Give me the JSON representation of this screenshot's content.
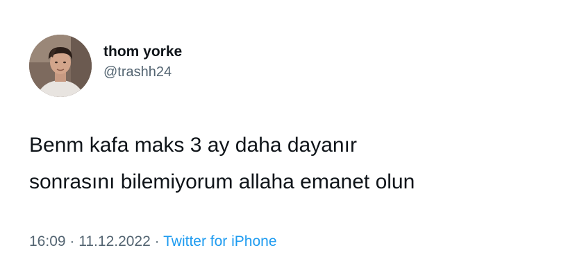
{
  "author": {
    "display_name": "thom yorke",
    "handle": "@trashh24"
  },
  "tweet": {
    "lines": [
      "Benm kafa maks 3 ay daha dayanır",
      "sonrasını bilemiyorum allaha emanet olun"
    ],
    "time": "16:09",
    "separator": "·",
    "date": "11.12.2022",
    "source": "Twitter for iPhone"
  },
  "colors": {
    "text": "#0f1419",
    "secondary": "#536471",
    "link": "#1d9bf0"
  },
  "icons": {
    "avatar": "profile-photo"
  }
}
